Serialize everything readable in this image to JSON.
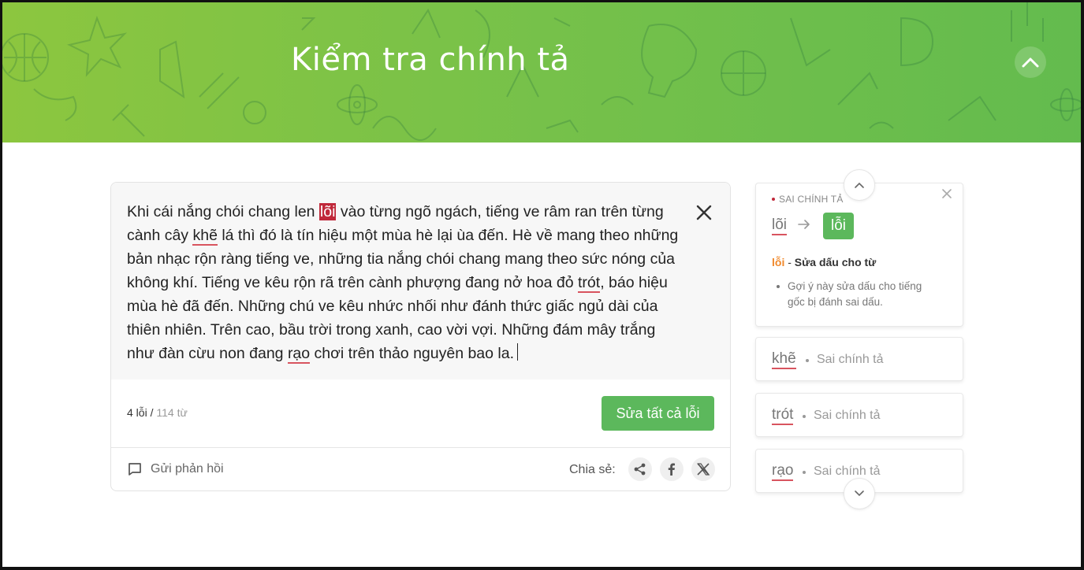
{
  "header": {
    "title": "Kiểm tra chính tả"
  },
  "editor": {
    "segments": [
      {
        "text": "Khi cái nắng chói chang len ",
        "type": "plain"
      },
      {
        "text": "lõi",
        "type": "active"
      },
      {
        "text": " vào từng ngõ ngách, tiếng ve râm ran trên từng cành cây ",
        "type": "plain"
      },
      {
        "text": "khẽ",
        "type": "error"
      },
      {
        "text": " lá thì đó là tín hiệu một mùa hè lại ùa đến. Hè về mang theo những bản nhạc rộn ràng tiếng ve, những tia nắng chói chang mang theo sức nóng của không khí. Tiếng ve kêu rộn rã trên cành phượng đang nở hoa đỏ ",
        "type": "plain"
      },
      {
        "text": "trót",
        "type": "error"
      },
      {
        "text": ", báo hiệu mùa hè đã đến. Những chú ve kêu nhức nhối như đánh thức giấc ngủ dài của thiên nhiên. Trên cao, bầu trời trong xanh, cao vời vợi. Những đám mây trắng như đàn cừu non đang ",
        "type": "plain"
      },
      {
        "text": "rạo",
        "type": "error"
      },
      {
        "text": " chơi trên thảo nguyên bao la.",
        "type": "plain"
      }
    ],
    "error_count": "4 lỗi /",
    "word_count": " 114 từ",
    "fix_all_label": "Sửa tất cả lỗi",
    "feedback_label": "Gửi phản hồi",
    "share_label": "Chia sẻ:"
  },
  "suggestions": {
    "main": {
      "type_label": "SAI CHÍNH TẢ",
      "wrong": "lõi",
      "right": "lỗi",
      "desc_word": "lỗi",
      "desc_sep": " - ",
      "desc_title": "Sửa dấu cho từ",
      "note": "Gợi ý này sửa dấu cho tiếng gốc bị đánh sai dấu."
    },
    "items": [
      {
        "word": "khẽ",
        "label": "Sai chính tả"
      },
      {
        "word": "trót",
        "label": "Sai chính tả"
      },
      {
        "word": "rạo",
        "label": "Sai chính tả"
      }
    ]
  },
  "colors": {
    "accent_green": "#5cb85c",
    "error_red": "#c0283a",
    "header_green": "#76c14a",
    "desc_orange": "#f0882a"
  },
  "icons": [
    "chevron-up-icon",
    "close-icon",
    "arrow-right-icon",
    "comment-icon",
    "share-icon",
    "facebook-icon",
    "x-icon",
    "chevron-down-icon"
  ]
}
